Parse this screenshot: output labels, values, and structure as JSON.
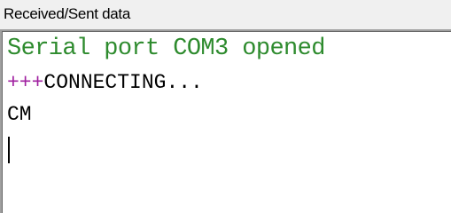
{
  "groupbox": {
    "label": "Received/Sent data"
  },
  "terminal": {
    "lines": [
      {
        "text": "Serial port COM3 opened",
        "color": "#2e8b2e"
      },
      {
        "prefix": "+++",
        "prefix_color": "#a020a0",
        "text": "CONNECTING...",
        "color": "#000000"
      },
      {
        "text": "CM",
        "color": "#000000"
      }
    ]
  }
}
